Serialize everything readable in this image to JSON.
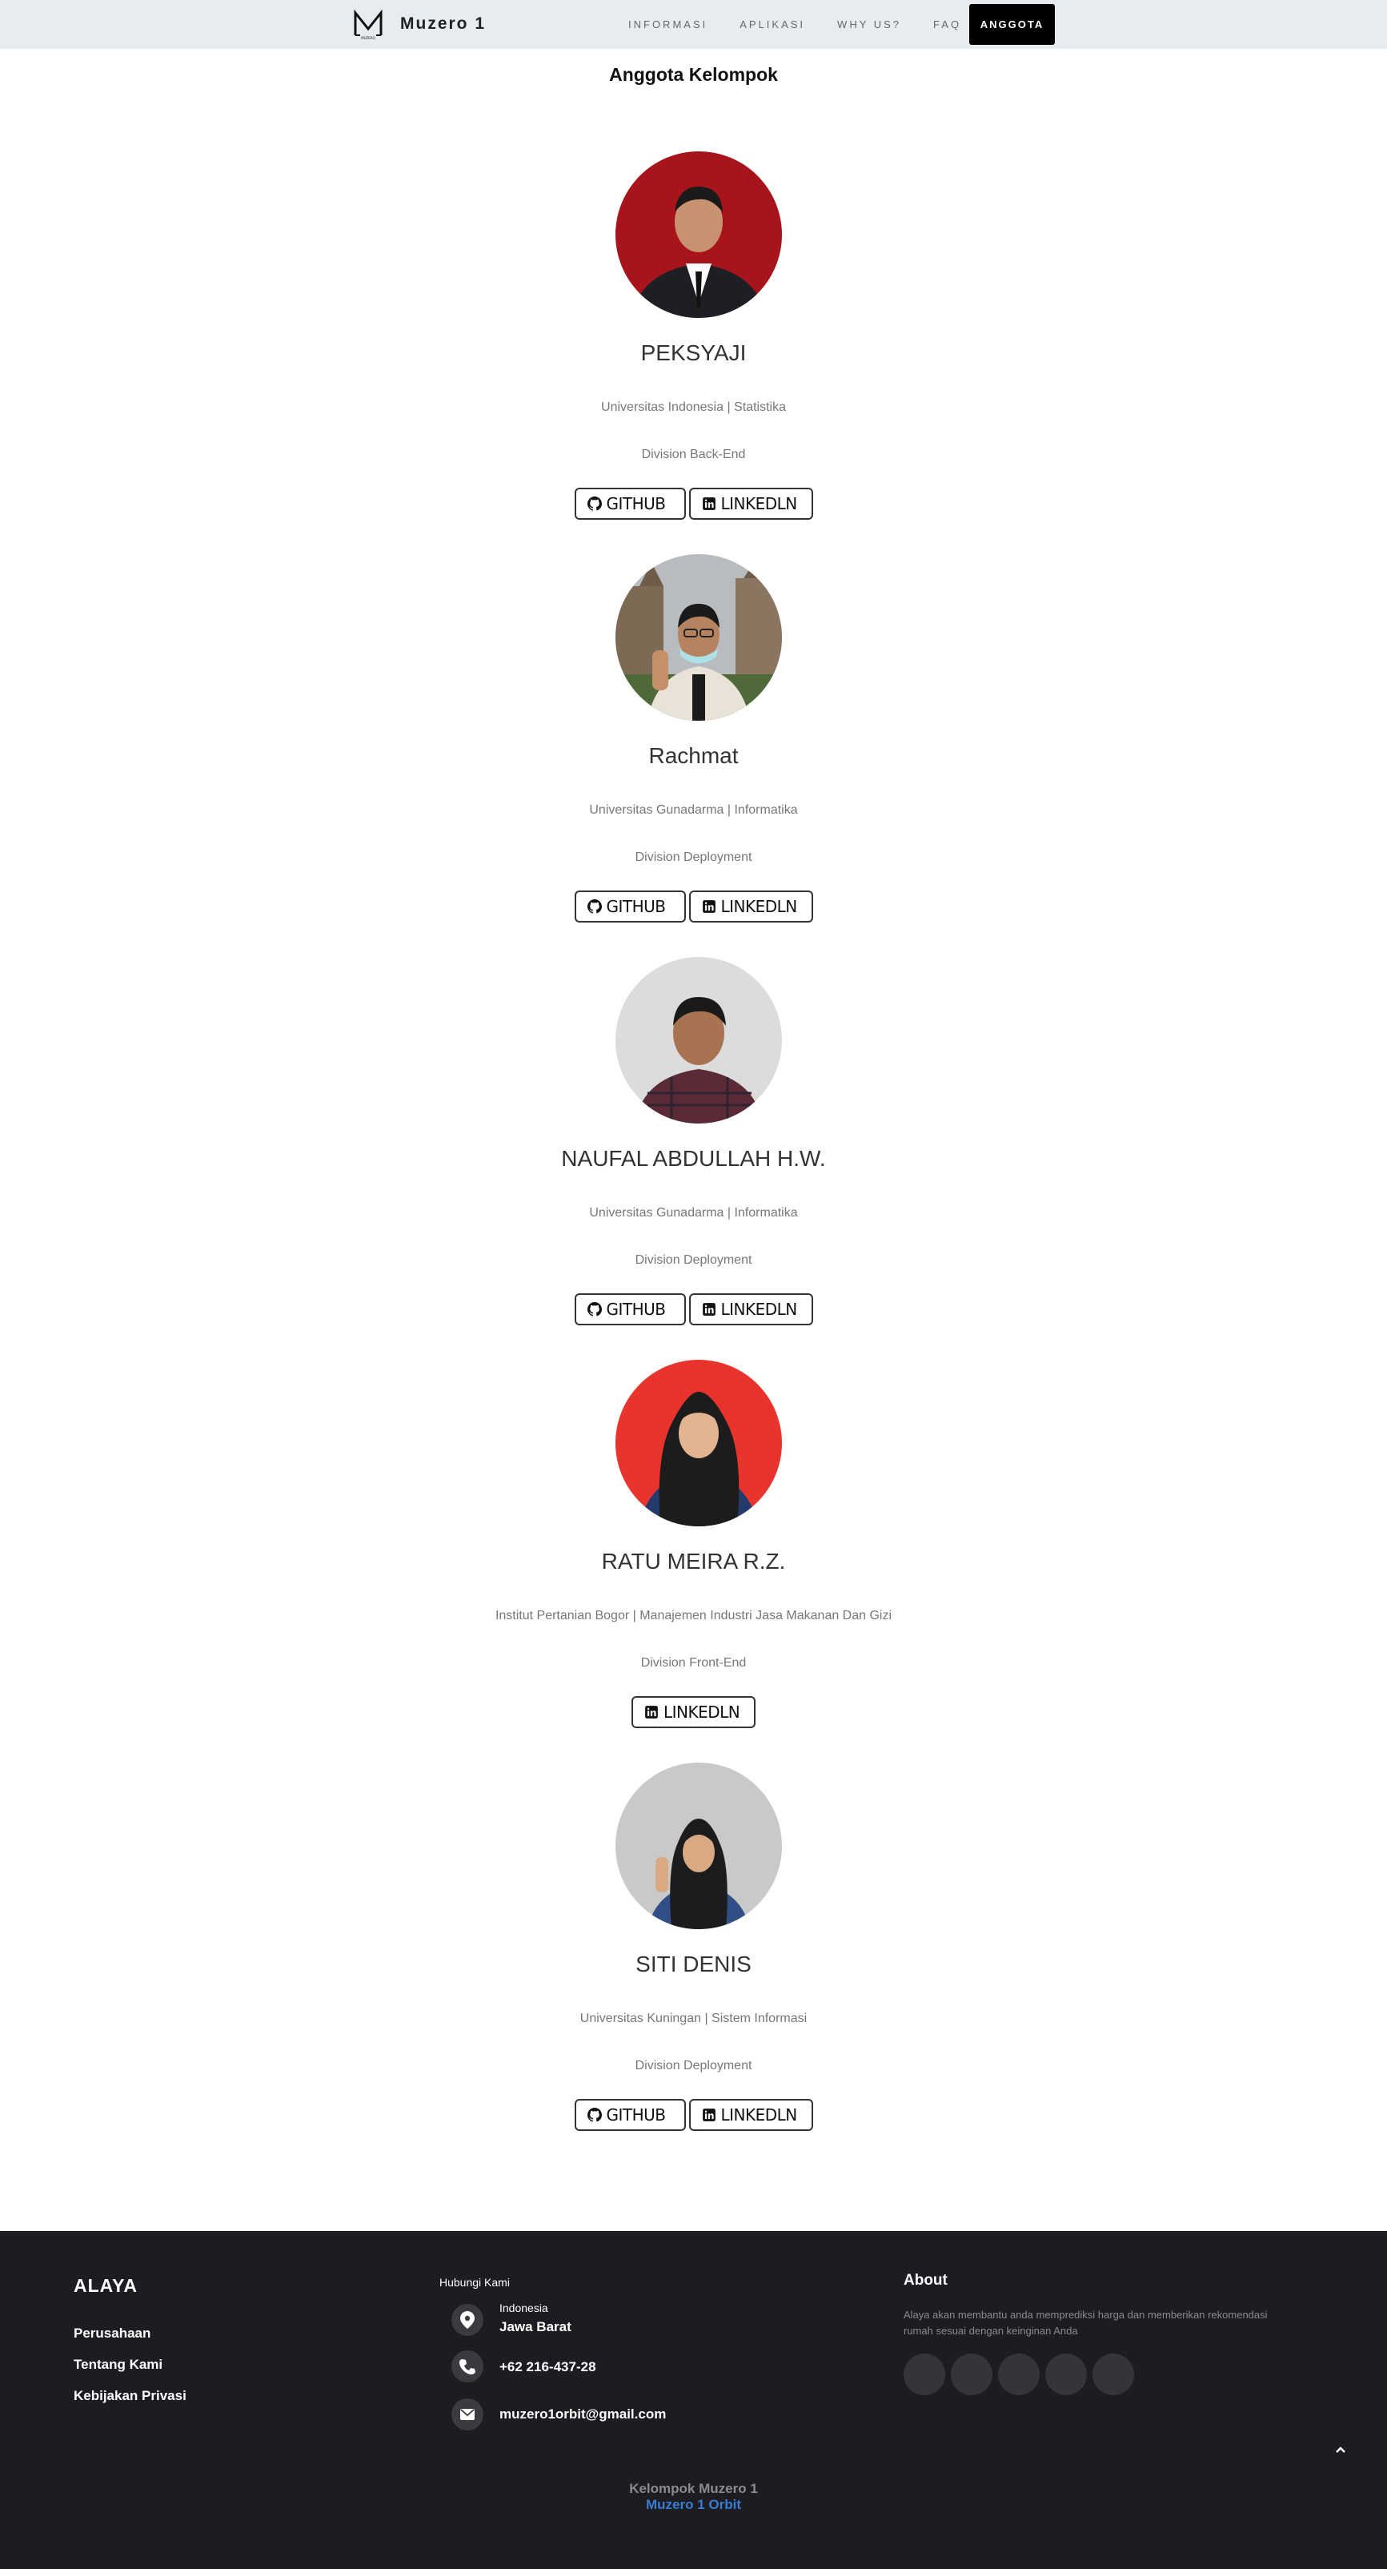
{
  "navbar": {
    "brand": "Muzero 1",
    "links": [
      "INFORMASI",
      "APLIKASI",
      "WHY US?",
      "FAQ"
    ],
    "cta": "ANGGOTA"
  },
  "section": {
    "title": "Anggota Kelompok"
  },
  "members": [
    {
      "name": "PEKSYAJI",
      "university": "Universitas Indonesia | Statistika",
      "division": "Division Back-End",
      "github": "GITHUB",
      "linkedin": "LINKEDLN",
      "bg": "#a8141b"
    },
    {
      "name": "Rachmat",
      "university": "Universitas Gunadarma | Informatika",
      "division": "Division Deployment",
      "github": "GITHUB",
      "linkedin": "LINKEDLN",
      "bg": "#8c8f8a"
    },
    {
      "name": "NAUFAL ABDULLAH H.W.",
      "university": "Universitas Gunadarma | Informatika",
      "division": "Division Deployment",
      "github": "GITHUB",
      "linkedin": "LINKEDLN",
      "bg": "#dcdcdc"
    },
    {
      "name": "RATU MEIRA R.Z.",
      "university": "Institut Pertanian Bogor | Manajemen Industri Jasa Makanan Dan Gizi",
      "division": "Division Front-End",
      "linkedin": "LINKEDLN",
      "bg": "#e8342c"
    },
    {
      "name": "SITI DENIS",
      "university": "Universitas Kuningan | Sistem Informasi",
      "division": "Division Deployment",
      "github": "GITHUB",
      "linkedin": "LINKEDLN",
      "bg": "#c9c9c9"
    }
  ],
  "footer": {
    "brand": "ALAYA",
    "links": [
      "Perusahaan",
      "Tentang Kami",
      "Kebijakan Privasi"
    ],
    "contact_heading": "Hubungi Kami",
    "location_country": "Indonesia",
    "location_region": "Jawa Barat",
    "phone": "+62 216-437-28",
    "email": "muzero1orbit@gmail.com",
    "about_heading": "About",
    "about_text": "Alaya akan membantu anda memprediksi harga dan memberikan rekomendasi rumah sesuai dengan keinginan Anda",
    "credit_line1": "Kelompok Muzero 1",
    "credit_line2": "Muzero 1 Orbit"
  },
  "colors": {
    "accent": "#3a7bd5",
    "footer_bg": "#1c1c21",
    "navbar_bg": "#e9ecef"
  },
  "icons": {
    "github": "github-icon",
    "linkedin": "linkedin-icon",
    "location": "location-pin-icon",
    "phone": "phone-icon",
    "email": "envelope-icon",
    "back_to_top": "chevron-up-icon"
  }
}
